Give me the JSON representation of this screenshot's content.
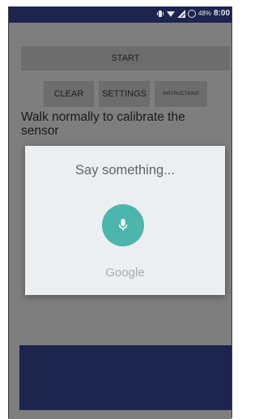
{
  "status_bar": {
    "battery_percent": "48%",
    "time": "8:00",
    "icons": [
      "vibrate-icon",
      "wifi-icon",
      "signal-icon",
      "battery-icon"
    ]
  },
  "buttons": {
    "start": "START",
    "clear": "CLEAR",
    "settings": "SETTINGS",
    "instructions": "INSTRUCTIONS"
  },
  "calibration_message": "Walk normally to calibrate the sensor",
  "voice_dialog": {
    "prompt": "Say something...",
    "brand": "Google",
    "mic_icon": "microphone-icon",
    "accent_color": "#4db6ac"
  },
  "colors": {
    "status_bar": "#1d244d",
    "overlay_background": "#7e7e7e",
    "bottom_panel": "#1d244d"
  }
}
